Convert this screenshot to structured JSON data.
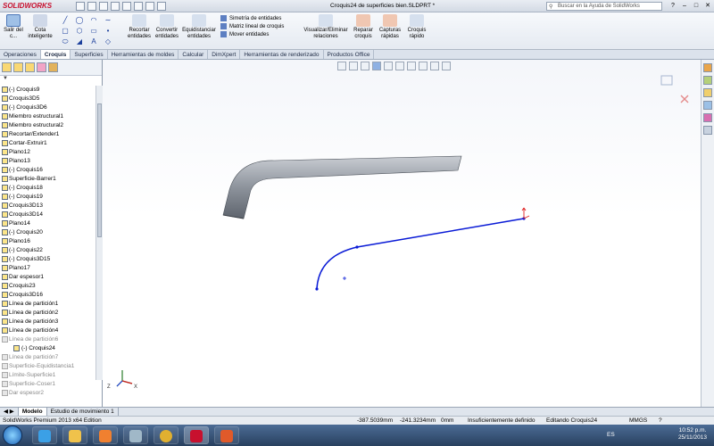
{
  "app": {
    "logo": "SOLIDWORKS",
    "document_title": "Croquis24 de superficies bien.SLDPRT *",
    "search_placeholder": "Buscar en la Ayuda de SolidWorks"
  },
  "ribbon": {
    "exit_sketch": "Salir del c...",
    "smart_dim": "Cota inteligente",
    "trim": "Recortar entidades",
    "convert": "Convertir entidades",
    "offset": "Equidistanciar entidades",
    "mirror": "Simetría de entidades",
    "linear_pattern": "Matriz lineal de croquis",
    "move": "Mover entidades",
    "relations": "Visualizar/Eliminar relaciones",
    "repair": "Reparar croquis",
    "snaps": "Capturas rápidas",
    "rapid": "Croquis rápido"
  },
  "tabs": [
    "Operaciones",
    "Croquis",
    "Superficies",
    "Herramientas de moldes",
    "Calcular",
    "DimXpert",
    "Herramientas de renderizado",
    "Productos Office"
  ],
  "tree": [
    {
      "label": "(-) Croquis9"
    },
    {
      "label": "Croquis3D5"
    },
    {
      "label": "(-) Croquis3D6"
    },
    {
      "label": "Miembro estructural1"
    },
    {
      "label": "Miembro estructural2"
    },
    {
      "label": "Recortar/Extender1"
    },
    {
      "label": "Cortar-Extruir1"
    },
    {
      "label": "Plano12"
    },
    {
      "label": "Plano13"
    },
    {
      "label": "(-) Croquis16"
    },
    {
      "label": "Superficie-Barrer1"
    },
    {
      "label": "(-) Croquis18"
    },
    {
      "label": "(-) Croquis19"
    },
    {
      "label": "Croquis3D13"
    },
    {
      "label": "Croquis3D14"
    },
    {
      "label": "Plano14"
    },
    {
      "label": "(-) Croquis20"
    },
    {
      "label": "Plano16"
    },
    {
      "label": "(-) Croquis22"
    },
    {
      "label": "(-) Croquis3D15"
    },
    {
      "label": "Plano17"
    },
    {
      "label": "Dar espesor1"
    },
    {
      "label": "Croquis23"
    },
    {
      "label": "Croquis3D16"
    },
    {
      "label": "Línea de partición1"
    },
    {
      "label": "Línea de partición2"
    },
    {
      "label": "Línea de partición3"
    },
    {
      "label": "Línea de partición4"
    },
    {
      "label": "Línea de partición6"
    },
    {
      "label": "(-) Croquis24"
    },
    {
      "label": "Línea de partición7"
    },
    {
      "label": "Superficie-Equidistancia1"
    },
    {
      "label": "Límite-Superficie1"
    },
    {
      "label": "Superficie-Coser1"
    },
    {
      "label": "Dar espesor2"
    }
  ],
  "bottom_tabs": [
    "Modelo",
    "Estudio de movimiento 1"
  ],
  "status": {
    "edition": "SolidWorks Premium 2013 x64 Edition",
    "x": "-387.5039mm",
    "y": "-241.3234mm",
    "z": "0mm",
    "state": "Insuficientemente definido",
    "editing": "Editando Croquis24",
    "units": "MMGS"
  },
  "taskbar": {
    "lang": "ES",
    "time": "10:52 p.m.",
    "date": "25/11/2013"
  },
  "colors": {
    "sketch_line": "#0a1bd6",
    "accent": "#c8102e"
  }
}
